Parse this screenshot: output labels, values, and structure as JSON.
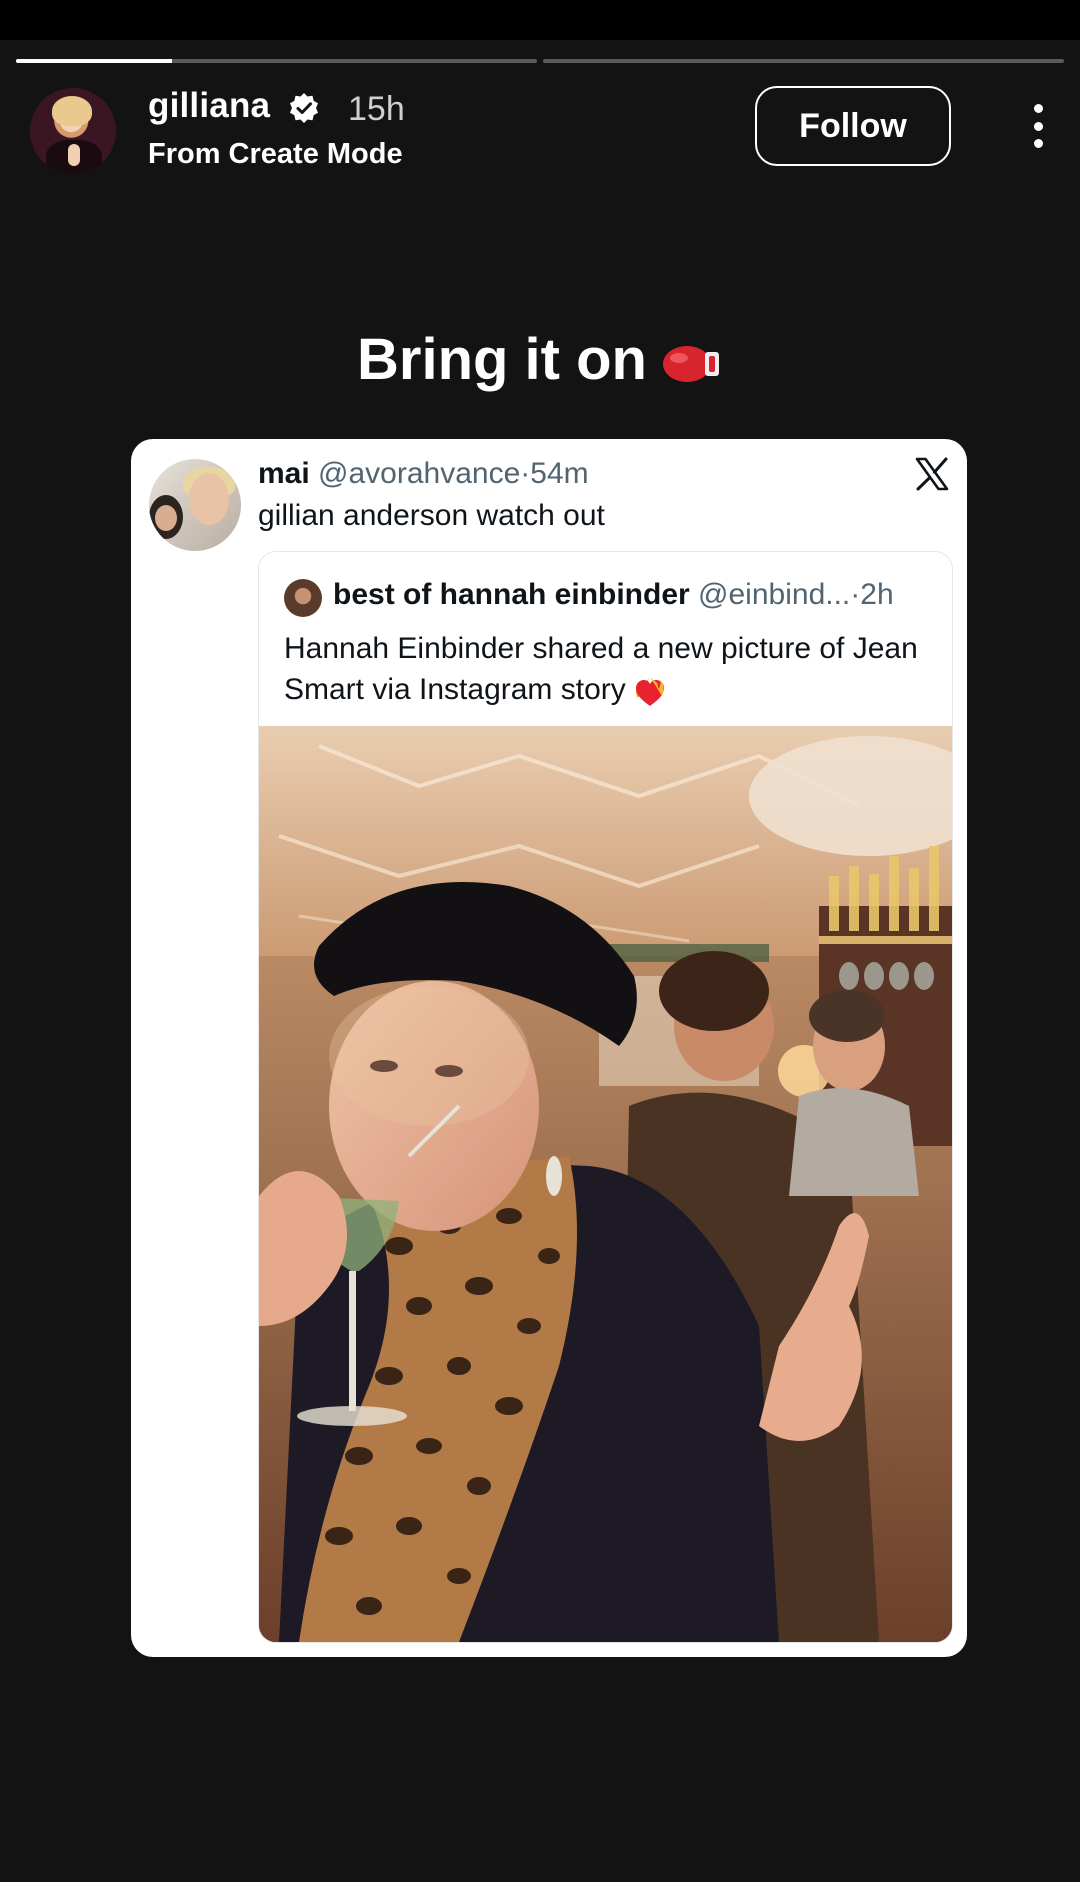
{
  "story": {
    "progress_segments": [
      0.3,
      0.0
    ],
    "user": {
      "name": "gilliana",
      "verified": true,
      "time_ago": "15h",
      "subtitle": "From Create Mode"
    },
    "follow_label": "Follow",
    "caption": "Bring it on",
    "caption_emoji": "boxing-glove-icon"
  },
  "tweet": {
    "display_name": "mai",
    "handle": "@avorahvance",
    "separator": "·",
    "time": "54m",
    "text": "gillian anderson watch out",
    "platform_icon": "x-logo-icon",
    "quoted": {
      "display_name": "best of hannah einbinder",
      "handle": "@einbind...",
      "separator": "·",
      "time": "2h",
      "text": "Hannah Einbinder shared a new picture of Jean Smart via Instagram story",
      "emoji": "heart-on-fire-icon"
    }
  },
  "colors": {
    "background": "#131313",
    "card_bg": "#ffffff",
    "text_primary": "#0f1419",
    "text_secondary": "#536471"
  }
}
